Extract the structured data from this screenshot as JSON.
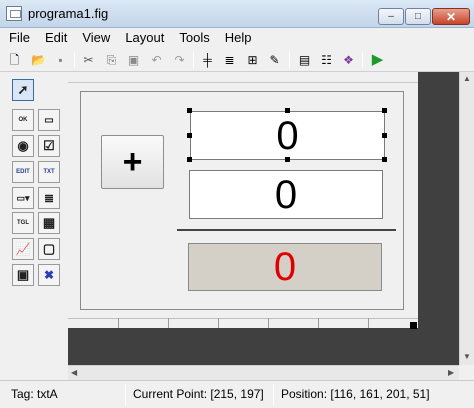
{
  "window": {
    "title": "programa1.fig",
    "controls": {
      "minimize": "–",
      "maximize": "□",
      "close": "✕"
    }
  },
  "menu": {
    "items": [
      "File",
      "Edit",
      "View",
      "Layout",
      "Tools",
      "Help"
    ]
  },
  "toolbar": {
    "buttons": [
      {
        "name": "new-icon",
        "glyph": "🗋"
      },
      {
        "name": "open-icon",
        "glyph": "📂"
      },
      {
        "name": "save-icon",
        "glyph": "▪"
      },
      {
        "name": "cut-icon",
        "glyph": "✂"
      },
      {
        "name": "copy-icon",
        "glyph": "⎘"
      },
      {
        "name": "paste-icon",
        "glyph": "▣"
      },
      {
        "name": "undo-icon",
        "glyph": "↶"
      },
      {
        "name": "redo-icon",
        "glyph": "↷"
      },
      {
        "name": "align-icon",
        "glyph": "╪"
      },
      {
        "name": "menu-editor-icon",
        "glyph": "≣"
      },
      {
        "name": "tab-order-icon",
        "glyph": "⊞"
      },
      {
        "name": "toolbar-editor-icon",
        "glyph": "✎"
      },
      {
        "name": "m-file-editor-icon",
        "glyph": "▤"
      },
      {
        "name": "property-inspector-icon",
        "glyph": "☷"
      },
      {
        "name": "object-browser-icon",
        "glyph": "❖"
      },
      {
        "name": "run-icon",
        "glyph": "▶"
      }
    ]
  },
  "palette": {
    "tools": [
      {
        "name": "select-tool-icon",
        "label": "➚"
      },
      {
        "name": "pushbutton-tool-icon",
        "label": "OK"
      },
      {
        "name": "slider-tool-icon",
        "label": "▭"
      },
      {
        "name": "radiobutton-tool-icon",
        "label": "◉"
      },
      {
        "name": "checkbox-tool-icon",
        "label": "☑"
      },
      {
        "name": "edit-text-tool-icon",
        "label": "EDIT"
      },
      {
        "name": "static-text-tool-icon",
        "label": "TXT"
      },
      {
        "name": "popup-menu-tool-icon",
        "label": "▭▾"
      },
      {
        "name": "listbox-tool-icon",
        "label": "≣"
      },
      {
        "name": "toggle-button-tool-icon",
        "label": "TGL"
      },
      {
        "name": "table-tool-icon",
        "label": "▦"
      },
      {
        "name": "axes-tool-icon",
        "label": "📈"
      },
      {
        "name": "panel-tool-icon",
        "label": "▢"
      },
      {
        "name": "button-group-tool-icon",
        "label": "▣"
      },
      {
        "name": "activex-tool-icon",
        "label": "✖"
      }
    ]
  },
  "figure": {
    "push_button_label": "+",
    "edit_a_value": "0",
    "edit_b_value": "0",
    "result_value": "0",
    "result_color": "#e00000"
  },
  "status": {
    "tag": "Tag: txtA",
    "current_point": "Current Point:  [215, 197]",
    "position": "Position: [116, 161, 201, 51]"
  }
}
